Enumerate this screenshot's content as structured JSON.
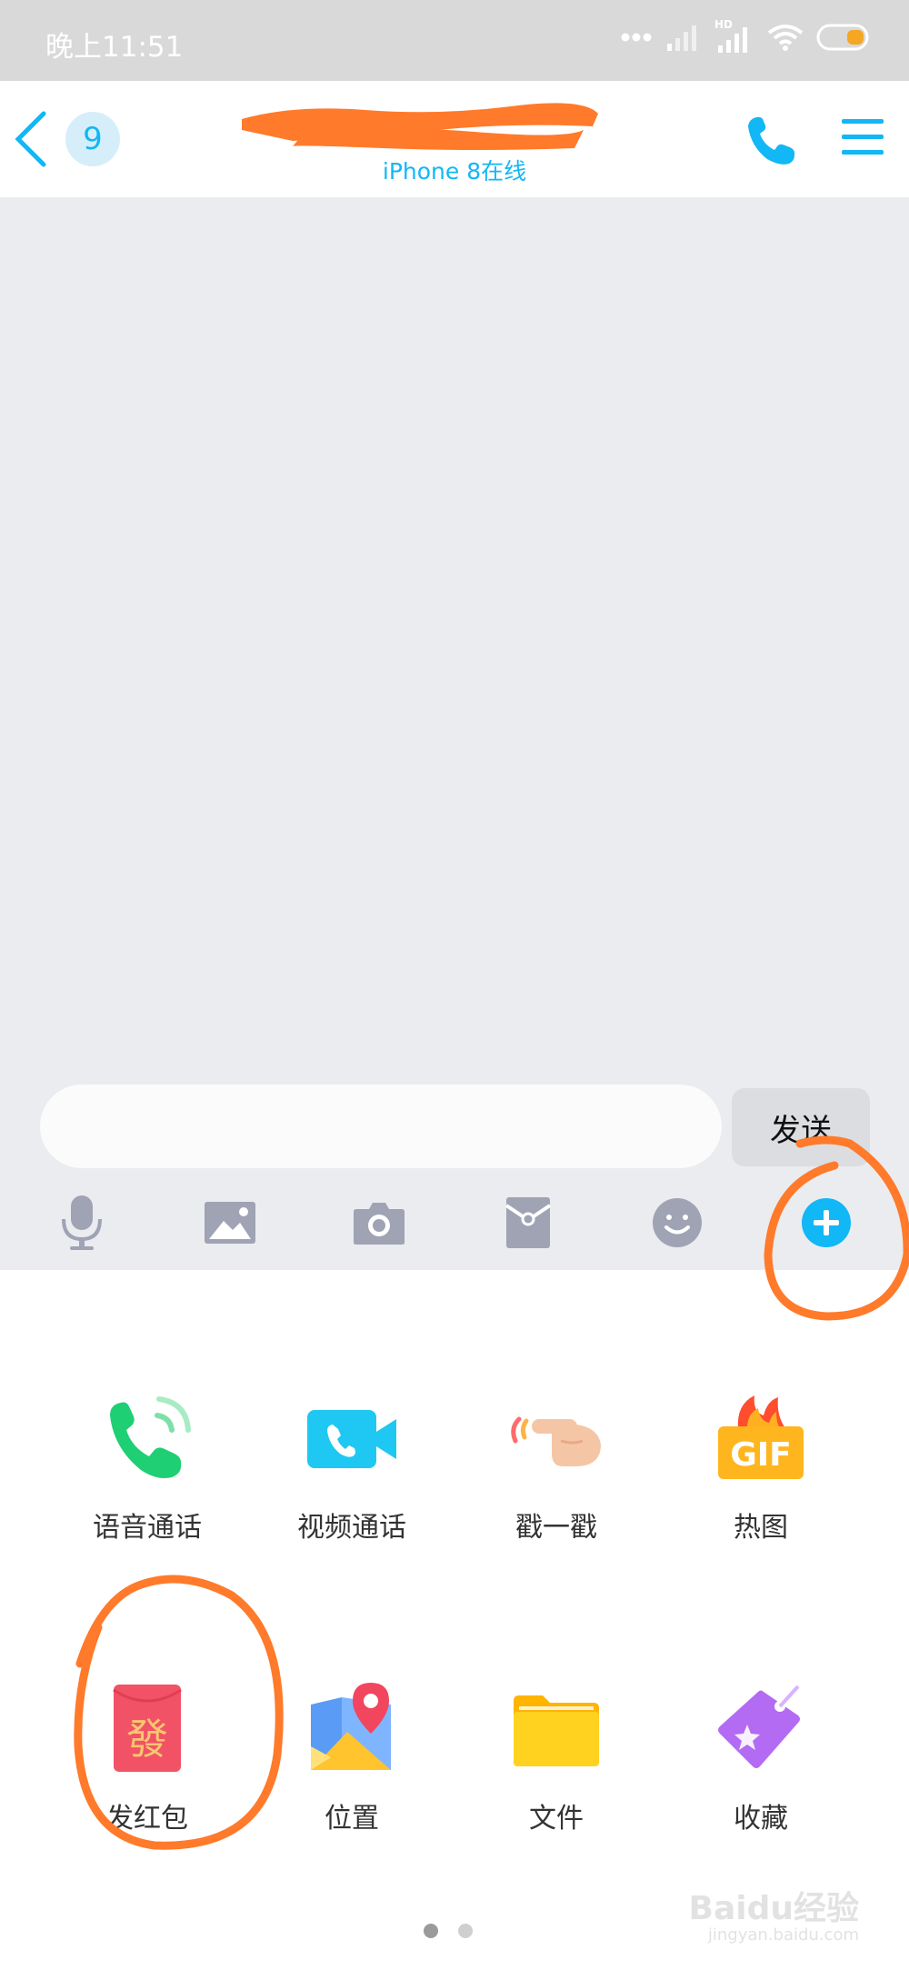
{
  "status_bar": {
    "time": "晚上11:51",
    "hd_label": "HD"
  },
  "header": {
    "unread_count": "9",
    "online_status": "iPhone 8在线"
  },
  "input": {
    "value": "",
    "send_label": "发送"
  },
  "toolbar": {
    "items": [
      "mic-icon",
      "image-icon",
      "camera-icon",
      "red-packet-icon",
      "emoji-icon",
      "plus-icon"
    ]
  },
  "panel": {
    "row1": [
      {
        "label": "语音通话",
        "icon": "voice-call-icon"
      },
      {
        "label": "视频通话",
        "icon": "video-call-icon"
      },
      {
        "label": "戳一戳",
        "icon": "poke-icon"
      },
      {
        "label": "热图",
        "icon": "gif-icon"
      }
    ],
    "row2": [
      {
        "label": "发红包",
        "icon": "red-envelope-icon"
      },
      {
        "label": "位置",
        "icon": "location-icon"
      },
      {
        "label": "文件",
        "icon": "folder-icon"
      },
      {
        "label": "收藏",
        "icon": "favorites-icon"
      }
    ],
    "gif_text": "GIF",
    "red_envelope_char": "發"
  },
  "watermark": {
    "text": "Baidu经验",
    "sub": "jingyan.baidu.com"
  },
  "colors": {
    "accent": "#12b7f5",
    "annotation": "#ff7a2a"
  }
}
